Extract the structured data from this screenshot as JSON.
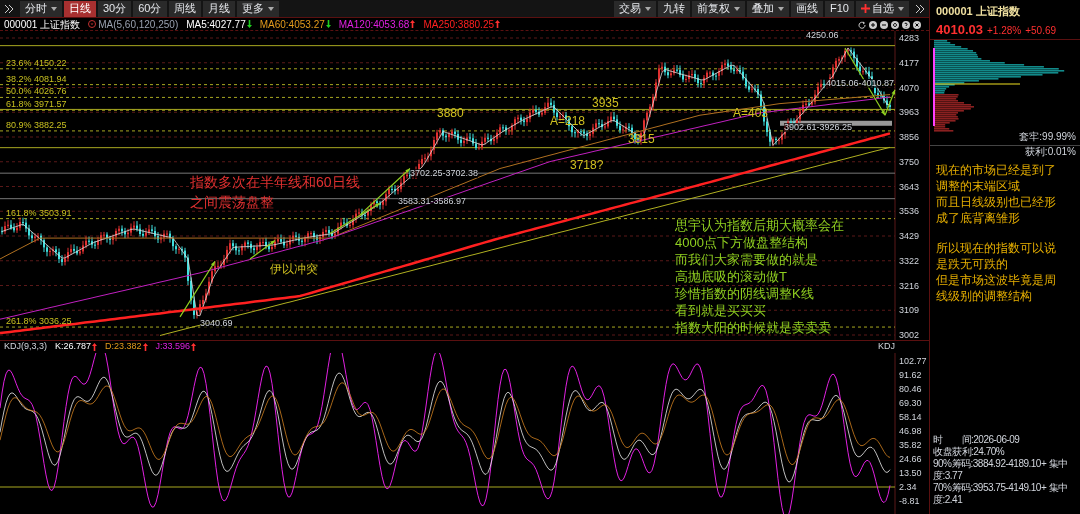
{
  "toolbar": {
    "tabs": [
      {
        "label": "分时",
        "selected": false,
        "dropdown": true
      },
      {
        "label": "日线",
        "selected": true,
        "dropdown": false
      },
      {
        "label": "30分",
        "selected": false,
        "dropdown": false
      },
      {
        "label": "60分",
        "selected": false,
        "dropdown": false
      },
      {
        "label": "周线",
        "selected": false,
        "dropdown": false
      },
      {
        "label": "月线",
        "selected": false,
        "dropdown": false
      },
      {
        "label": "更多",
        "selected": false,
        "dropdown": true
      }
    ],
    "buttons": [
      {
        "label": "交易",
        "kind": "menu"
      },
      {
        "label": "九转",
        "kind": "plain"
      },
      {
        "label": "前复权",
        "kind": "menu"
      },
      {
        "label": "叠加",
        "kind": "menu"
      },
      {
        "label": "画线",
        "kind": "plain"
      },
      {
        "label": "F10",
        "kind": "plain"
      },
      {
        "label": "自选",
        "kind": "add"
      }
    ]
  },
  "chart_header": {
    "symbol": "000001 上证指数",
    "indicator": "MA(5,60,120,250)",
    "ma_values": [
      {
        "text": "MA5:4027.77",
        "rising": false
      },
      {
        "text": "MA60:4053.27",
        "rising": false
      },
      {
        "text": "MA120:4053.68",
        "rising": true
      },
      {
        "text": "MA250:3880.25",
        "rising": true
      }
    ]
  },
  "price_axis": [
    "4283",
    "4177",
    "4070",
    "3963",
    "3856",
    "3750",
    "3643",
    "3536",
    "3429",
    "3322",
    "3216",
    "3109",
    "3002"
  ],
  "fib_levels": [
    "23.6% 4150.22",
    "38.2% 4081.94",
    "50.0% 4026.76",
    "61.8% 3971.57",
    "80.9% 3882.25",
    "161.8% 3503.91",
    "261.8% 3036.25"
  ],
  "annotations": [
    {
      "text": "4250.06",
      "kind": "tag"
    },
    {
      "text": "4015.06-4010.87",
      "kind": "tag"
    },
    {
      "text": "3935",
      "kind": "label"
    },
    {
      "text": "3880",
      "kind": "label"
    },
    {
      "text": "A=403",
      "kind": "label"
    },
    {
      "text": "A=218",
      "kind": "label"
    },
    {
      "text": "3902.61-3926.25",
      "kind": "tag"
    },
    {
      "text": "3815",
      "kind": "label"
    },
    {
      "text": "3718?",
      "kind": "label"
    },
    {
      "text": "3702.25-3702.38",
      "kind": "tag"
    },
    {
      "text": "指数多次在半年线和60日线",
      "kind": "callout"
    },
    {
      "text": "之间震荡盘整",
      "kind": "callout"
    },
    {
      "text": "3583.31-3586.97",
      "kind": "tag"
    },
    {
      "text": "伊以冲突",
      "kind": "label"
    },
    {
      "text": "3040.69",
      "kind": "tag"
    }
  ],
  "strategy_note": [
    "思宇认为指数后期大概率会在",
    "4000点下方做盘整结构",
    "而我们大家需要做的就是",
    "高抛底吸的滚动做T",
    "珍惜指数的阴线调整K线",
    "看到就是买买买",
    "指数大阳的时候就是卖卖卖"
  ],
  "kdj": {
    "label": "KDJ(9,3,3)",
    "values": [
      {
        "text": "K:26.787",
        "rising": true
      },
      {
        "text": "D:23.382",
        "rising": true
      },
      {
        "text": "J:33.596",
        "rising": true
      }
    ],
    "name": "KDJ",
    "axis": [
      "102.77",
      "91.62",
      "80.46",
      "69.30",
      "58.14",
      "46.98",
      "35.82",
      "24.66",
      "13.50",
      "2.34",
      "-8.81"
    ]
  },
  "quote": {
    "symbol": "000001 上证指数",
    "price": "4010.03",
    "change_pct": "+1.28%",
    "change": "+50.69"
  },
  "chip": {
    "trapped": "套牢:99.99%",
    "profit": "获利:0.01%"
  },
  "commentary": [
    [
      "现在的市场已经是到了",
      "调整的末端区域",
      "而且日线级别也已经形",
      "成了底背离雏形"
    ],
    [
      "所以现在的指数可以说",
      "是跌无可跌的",
      "但是市场这波毕竟是周",
      "线级别的调整结构"
    ]
  ],
  "stats": [
    "时　　间:2026-06-09",
    "收盘获利:24.70%",
    "90%筹码:3884.92-4189.10+ 集中度:3.77",
    "70%筹码:3953.75-4149.10+ 集中度:2.41"
  ]
}
